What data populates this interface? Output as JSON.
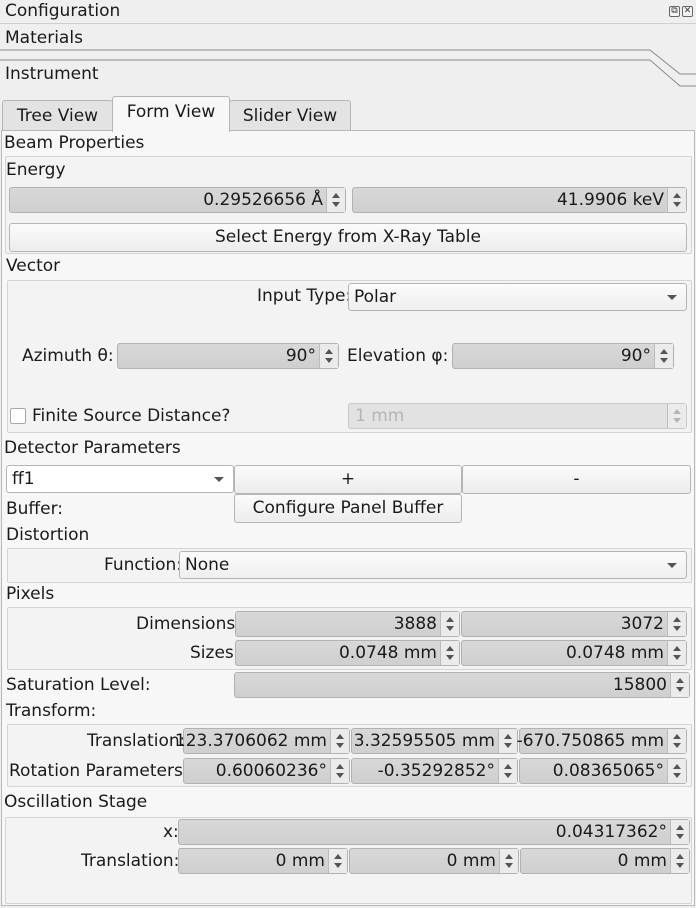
{
  "dock": {
    "title": "Configuration",
    "float_icon": "float-icon",
    "close_icon": "close-icon"
  },
  "toolbox": {
    "materials_label": "Materials",
    "instrument_label": "Instrument"
  },
  "tabs": [
    {
      "label": "Tree View",
      "active": false
    },
    {
      "label": "Form View",
      "active": true
    },
    {
      "label": "Slider View",
      "active": false
    }
  ],
  "beam": {
    "section_label": "Beam Properties",
    "energy_label": "Energy",
    "wavelength": "0.29526656 Å",
    "energy_kev": "41.9906 keV",
    "select_energy_button": "Select Energy from X-Ray Table",
    "vector_label": "Vector",
    "input_type_label": "Input Type:",
    "input_type_value": "Polar",
    "azimuth_label": "Azimuth θ:",
    "azimuth_value": "90°",
    "elevation_label": "Elevation φ:",
    "elevation_value": "90°",
    "finite_source_label": "Finite Source Distance?",
    "finite_source_value": "1 mm"
  },
  "detector": {
    "section_label": "Detector Parameters",
    "selected_detector": "ff1",
    "add_button": "+",
    "remove_button": "-",
    "buffer_label": "Buffer:",
    "configure_buffer_button": "Configure Panel Buffer",
    "distortion_label": "Distortion",
    "function_label": "Function:",
    "function_value": "None",
    "pixels_label": "Pixels",
    "dimensions_label": "Dimensions:",
    "dimension_rows": "3888",
    "dimension_cols": "3072",
    "sizes_label": "Sizes:",
    "size_row": "0.0748 mm",
    "size_col": "0.0748 mm",
    "saturation_label": "Saturation Level:",
    "saturation_value": "15800",
    "transform_label": "Transform:",
    "translation_label": "Translation:",
    "translation": [
      "123.3706062 mm",
      "3.32595505 mm",
      "-670.750865 mm"
    ],
    "rotation_label": "Rotation Parameters:",
    "rotation": [
      "0.60060236°",
      "-0.35292852°",
      "0.08365065°"
    ]
  },
  "oscillation": {
    "section_label": "Oscillation Stage",
    "x_label": "x:",
    "x_value": "0.04317362°",
    "translation_label": "Translation:",
    "translation": [
      "0 mm",
      "0 mm",
      "0 mm"
    ]
  }
}
